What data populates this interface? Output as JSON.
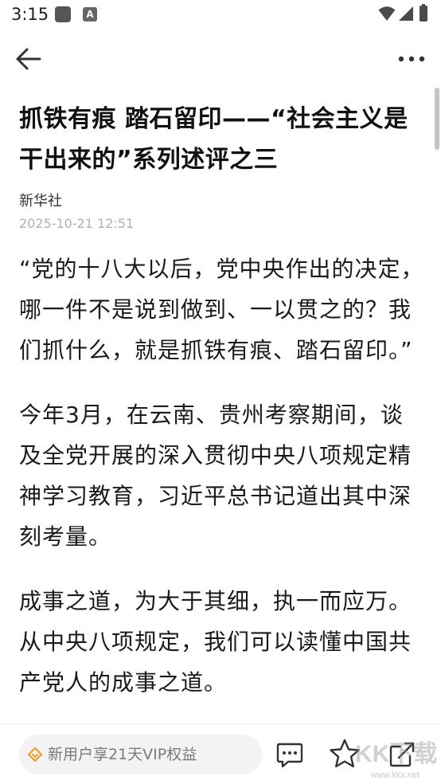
{
  "status_bar": {
    "time": "3:15",
    "app_badge": "A"
  },
  "article": {
    "title": "抓铁有痕 踏石留印——“社会主义是干出来的”系列述评之三",
    "source": "新华社",
    "datetime": "2025-10-21 12:51",
    "paragraphs": [
      "“党的十八大以后，党中央作出的决定，哪一件不是说到做到、一以贯之的？我们抓什么，就是抓铁有痕、踏石留印。”",
      "今年3月，在云南、贵州考察期间，谈及全党开展的深入贯彻中央八项规定精神学习教育，习近平总书记道出其中深刻考量。",
      "成事之道，为大于其细，执一而应万。从中央八项规定，我们可以读懂中国共产党人的成事之道。"
    ]
  },
  "bottom_bar": {
    "vip_text": "新用户享21天VIP权益",
    "watermark_text": "KK下载",
    "watermark_url": "www.kkx.net"
  },
  "icons": {
    "back": "arrow-left-icon",
    "more": "more-dots-icon",
    "vip": "vip-diamond-icon",
    "comment": "comment-icon",
    "star": "star-icon",
    "share": "share-icon"
  },
  "colors": {
    "accent": "#f0a020",
    "text": "#1a1a1a",
    "muted": "#b0b0b0"
  }
}
